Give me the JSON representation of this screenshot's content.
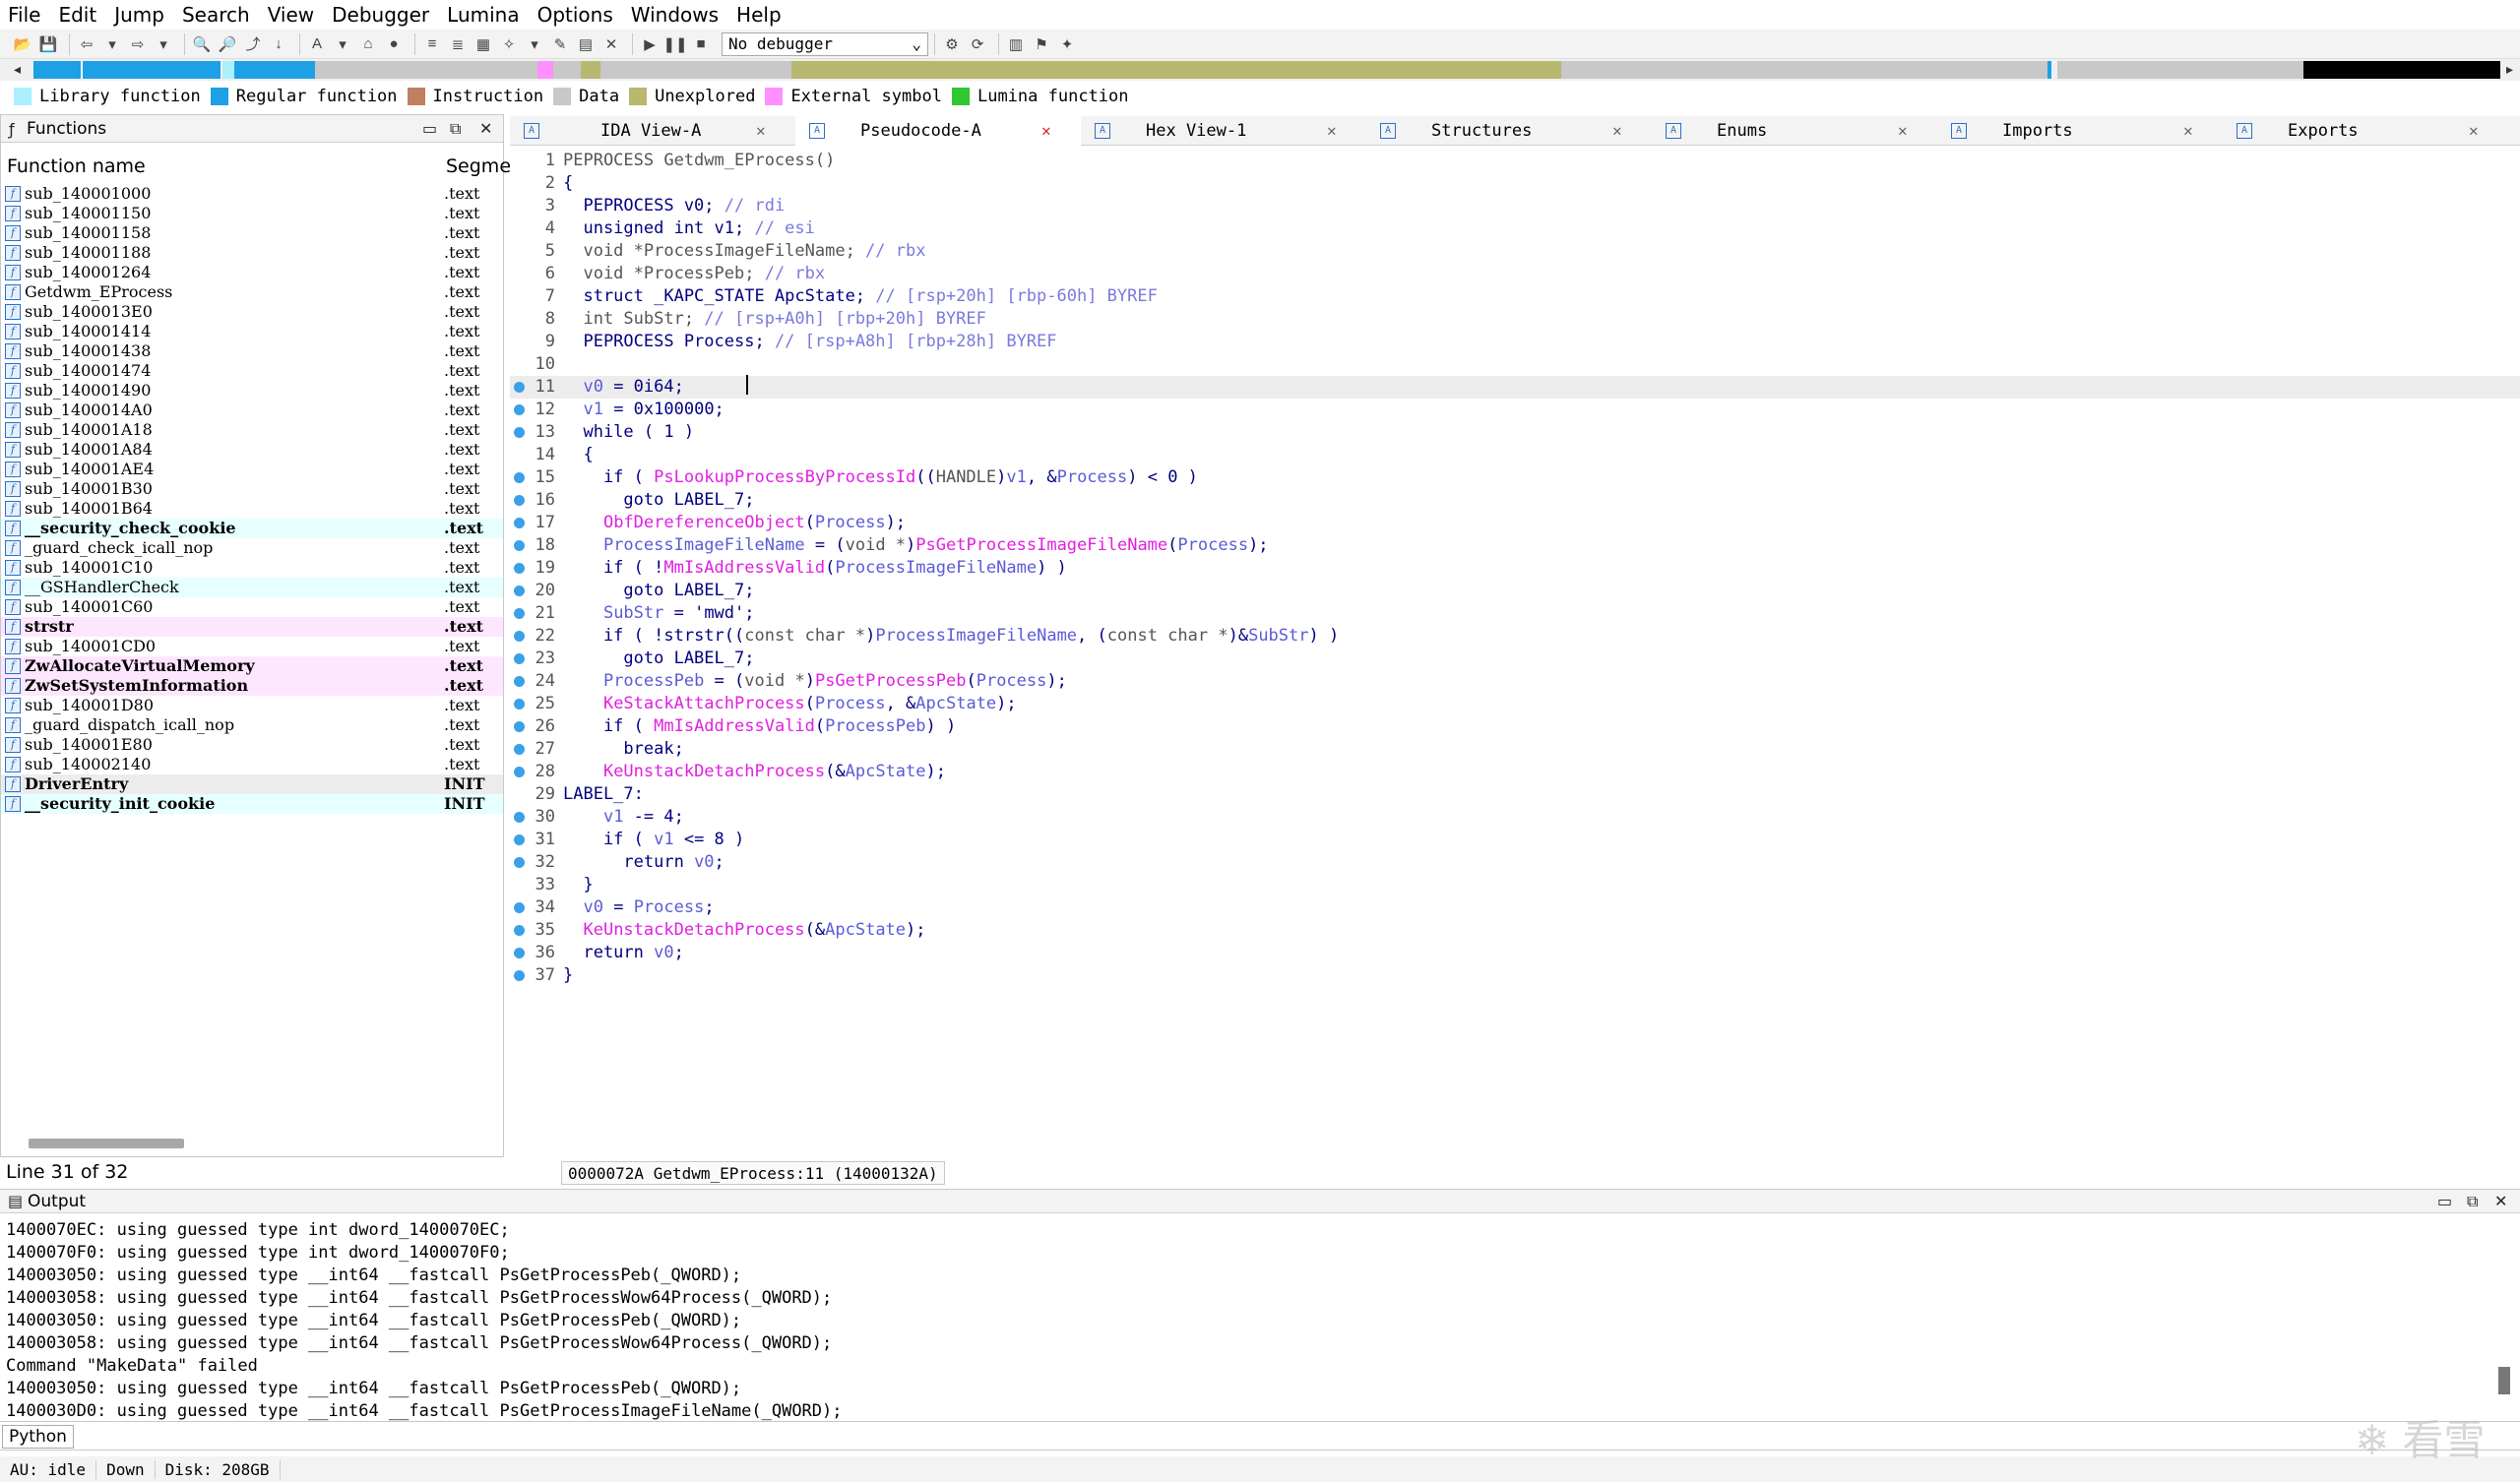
{
  "menu": [
    "File",
    "Edit",
    "Jump",
    "Search",
    "View",
    "Debugger",
    "Lumina",
    "Options",
    "Windows",
    "Help"
  ],
  "toolbar": {
    "debugger_value": "No debugger"
  },
  "legend": [
    {
      "label": "Library function",
      "color": "#aaf0ff"
    },
    {
      "label": "Regular function",
      "color": "#1ea0e6"
    },
    {
      "label": "Instruction",
      "color": "#c08060"
    },
    {
      "label": "Data",
      "color": "#c8c8c8"
    },
    {
      "label": "Unexplored",
      "color": "#b8b870"
    },
    {
      "label": "External symbol",
      "color": "#ff90ff"
    },
    {
      "label": "Lumina function",
      "color": "#30c830"
    }
  ],
  "functions_panel": {
    "title": "Functions",
    "col_name": "Function name",
    "col_segment": "Segme",
    "rows": [
      {
        "name": "sub_140001000",
        "seg": ".text",
        "kind": "reg"
      },
      {
        "name": "sub_140001150",
        "seg": ".text",
        "kind": "reg"
      },
      {
        "name": "sub_140001158",
        "seg": ".text",
        "kind": "reg"
      },
      {
        "name": "sub_140001188",
        "seg": ".text",
        "kind": "reg"
      },
      {
        "name": "sub_140001264",
        "seg": ".text",
        "kind": "reg"
      },
      {
        "name": "Getdwm_EProcess",
        "seg": ".text",
        "kind": "reg"
      },
      {
        "name": "sub_1400013E0",
        "seg": ".text",
        "kind": "reg"
      },
      {
        "name": "sub_140001414",
        "seg": ".text",
        "kind": "reg"
      },
      {
        "name": "sub_140001438",
        "seg": ".text",
        "kind": "reg"
      },
      {
        "name": "sub_140001474",
        "seg": ".text",
        "kind": "reg"
      },
      {
        "name": "sub_140001490",
        "seg": ".text",
        "kind": "reg"
      },
      {
        "name": "sub_1400014A0",
        "seg": ".text",
        "kind": "reg"
      },
      {
        "name": "sub_140001A18",
        "seg": ".text",
        "kind": "reg"
      },
      {
        "name": "sub_140001A84",
        "seg": ".text",
        "kind": "reg"
      },
      {
        "name": "sub_140001AE4",
        "seg": ".text",
        "kind": "reg"
      },
      {
        "name": "sub_140001B30",
        "seg": ".text",
        "kind": "reg"
      },
      {
        "name": "sub_140001B64",
        "seg": ".text",
        "kind": "reg"
      },
      {
        "name": "__security_check_cookie",
        "seg": ".text",
        "kind": "lib",
        "bold": true
      },
      {
        "name": "_guard_check_icall_nop",
        "seg": ".text",
        "kind": "reg"
      },
      {
        "name": "sub_140001C10",
        "seg": ".text",
        "kind": "reg"
      },
      {
        "name": "__GSHandlerCheck",
        "seg": ".text",
        "kind": "lib"
      },
      {
        "name": "sub_140001C60",
        "seg": ".text",
        "kind": "reg"
      },
      {
        "name": "strstr",
        "seg": ".text",
        "kind": "ext",
        "bold": true
      },
      {
        "name": "sub_140001CD0",
        "seg": ".text",
        "kind": "reg"
      },
      {
        "name": "ZwAllocateVirtualMemory",
        "seg": ".text",
        "kind": "ext",
        "bold": true
      },
      {
        "name": "ZwSetSystemInformation",
        "seg": ".text",
        "kind": "ext",
        "bold": true
      },
      {
        "name": "sub_140001D80",
        "seg": ".text",
        "kind": "reg"
      },
      {
        "name": "_guard_dispatch_icall_nop",
        "seg": ".text",
        "kind": "reg"
      },
      {
        "name": "sub_140001E80",
        "seg": ".text",
        "kind": "reg"
      },
      {
        "name": "sub_140002140",
        "seg": ".text",
        "kind": "reg"
      },
      {
        "name": "DriverEntry",
        "seg": "INIT",
        "kind": "sel",
        "bold": true
      },
      {
        "name": "__security_init_cookie",
        "seg": "INIT",
        "kind": "lib",
        "bold": true
      }
    ],
    "status": "Line 31 of 32"
  },
  "tabs": [
    {
      "label": "IDA View-A",
      "icon": "ida-view-icon"
    },
    {
      "label": "Pseudocode-A",
      "icon": "pseudocode-icon",
      "active": true
    },
    {
      "label": "Hex View-1",
      "icon": "hex-view-icon"
    },
    {
      "label": "Structures",
      "icon": "structures-icon"
    },
    {
      "label": "Enums",
      "icon": "enums-icon"
    },
    {
      "label": "Imports",
      "icon": "imports-icon"
    },
    {
      "label": "Exports",
      "icon": "exports-icon"
    }
  ],
  "pseudocode": {
    "lines": [
      {
        "n": "1",
        "dot": false,
        "html": "<span class='gray'>PEPROCESS Getdwm_EProcess()</span>"
      },
      {
        "n": "2",
        "dot": false,
        "html": "<span class='kw'>{</span>"
      },
      {
        "n": "3",
        "dot": false,
        "html": "<span class='kw'>  PEPROCESS v0; </span><span class='cm'>// rdi</span>"
      },
      {
        "n": "4",
        "dot": false,
        "html": "<span class='kw'>  unsigned int v1; </span><span class='cm'>// esi</span>"
      },
      {
        "n": "5",
        "dot": false,
        "html": "<span class='gray'>  void *ProcessImageFileName; </span><span class='cm'>// rbx</span>"
      },
      {
        "n": "6",
        "dot": false,
        "html": "<span class='gray'>  void *ProcessPeb; </span><span class='cm'>// rbx</span>"
      },
      {
        "n": "7",
        "dot": false,
        "html": "<span class='kw'>  struct _KAPC_STATE ApcState; </span><span class='cm'>// [rsp+20h] [rbp-60h] BYREF</span>"
      },
      {
        "n": "8",
        "dot": false,
        "html": "<span class='gray'>  int SubStr; </span><span class='cm'>// [rsp+A0h] [rbp+20h] BYREF</span>"
      },
      {
        "n": "9",
        "dot": false,
        "html": "<span class='kw'>  PEPROCESS Process; </span><span class='cm'>// [rsp+A8h] [rbp+28h] BYREF</span>"
      },
      {
        "n": "10",
        "dot": false,
        "html": ""
      },
      {
        "n": "11",
        "dot": true,
        "cur": true,
        "html": "  <span class='vr'>v0</span><span class='kw'> = 0i64;</span>"
      },
      {
        "n": "12",
        "dot": true,
        "html": "  <span class='vr'>v1</span><span class='kw'> = 0x100000;</span>"
      },
      {
        "n": "13",
        "dot": true,
        "html": "<span class='kw'>  while ( 1 )</span>"
      },
      {
        "n": "14",
        "dot": false,
        "html": "<span class='kw'>  {</span>"
      },
      {
        "n": "15",
        "dot": true,
        "html": "<span class='kw'>    if ( </span><span class='fn'>PsLookupProcessByProcessId</span><span class='kw'>((</span><span class='gray'>HANDLE</span><span class='kw'>)</span><span class='vr'>v1</span><span class='kw'>, &amp;</span><span class='vr'>Process</span><span class='kw'>) &lt; 0 )</span>"
      },
      {
        "n": "16",
        "dot": true,
        "html": "<span class='kw'>      goto LABEL_7;</span>"
      },
      {
        "n": "17",
        "dot": true,
        "html": "    <span class='fn'>ObfDereferenceObject</span><span class='kw'>(</span><span class='vr'>Process</span><span class='kw'>);</span>"
      },
      {
        "n": "18",
        "dot": true,
        "html": "    <span class='vr'>ProcessImageFileName</span><span class='kw'> = (</span><span class='gray'>void *</span><span class='kw'>)</span><span class='fn'>PsGetProcessImageFileName</span><span class='kw'>(</span><span class='vr'>Process</span><span class='kw'>);</span>"
      },
      {
        "n": "19",
        "dot": true,
        "html": "<span class='kw'>    if ( !</span><span class='fn'>MmIsAddressValid</span><span class='kw'>(</span><span class='vr'>ProcessImageFileName</span><span class='kw'>) )</span>"
      },
      {
        "n": "20",
        "dot": true,
        "html": "<span class='kw'>      goto LABEL_7;</span>"
      },
      {
        "n": "21",
        "dot": true,
        "html": "    <span class='vr'>SubStr</span><span class='kw'> = 'mwd';</span>"
      },
      {
        "n": "22",
        "dot": true,
        "html": "<span class='kw'>    if ( !</span><span class='st'>strstr</span><span class='kw'>((</span><span class='gray'>const char *</span><span class='kw'>)</span><span class='vr'>ProcessImageFileName</span><span class='kw'>, (</span><span class='gray'>const char *</span><span class='kw'>)&amp;</span><span class='vr'>SubStr</span><span class='kw'>) )</span>"
      },
      {
        "n": "23",
        "dot": true,
        "html": "<span class='kw'>      goto LABEL_7;</span>"
      },
      {
        "n": "24",
        "dot": true,
        "html": "    <span class='vr'>ProcessPeb</span><span class='kw'> = (</span><span class='gray'>void *</span><span class='kw'>)</span><span class='fn'>PsGetProcessPeb</span><span class='kw'>(</span><span class='vr'>Process</span><span class='kw'>);</span>"
      },
      {
        "n": "25",
        "dot": true,
        "html": "    <span class='fn'>KeStackAttachProcess</span><span class='kw'>(</span><span class='vr'>Process</span><span class='kw'>, &amp;</span><span class='vr'>ApcState</span><span class='kw'>);</span>"
      },
      {
        "n": "26",
        "dot": true,
        "html": "<span class='kw'>    if ( </span><span class='fn'>MmIsAddressValid</span><span class='kw'>(</span><span class='vr'>ProcessPeb</span><span class='kw'>) )</span>"
      },
      {
        "n": "27",
        "dot": true,
        "html": "<span class='kw'>      break;</span>"
      },
      {
        "n": "28",
        "dot": true,
        "html": "    <span class='fn'>KeUnstackDetachProcess</span><span class='kw'>(&amp;</span><span class='vr'>ApcState</span><span class='kw'>);</span>"
      },
      {
        "n": "29",
        "dot": false,
        "html": "<span class='kw'>LABEL_7:</span>"
      },
      {
        "n": "30",
        "dot": true,
        "html": "    <span class='vr'>v1</span><span class='kw'> -= 4;</span>"
      },
      {
        "n": "31",
        "dot": true,
        "html": "<span class='kw'>    if ( </span><span class='vr'>v1</span><span class='kw'> &lt;= 8 )</span>"
      },
      {
        "n": "32",
        "dot": true,
        "html": "<span class='kw'>      return </span><span class='vr'>v0</span><span class='kw'>;</span>"
      },
      {
        "n": "33",
        "dot": false,
        "html": "<span class='kw'>  }</span>"
      },
      {
        "n": "34",
        "dot": true,
        "html": "  <span class='vr'>v0</span><span class='kw'> = </span><span class='vr'>Process</span><span class='kw'>;</span>"
      },
      {
        "n": "35",
        "dot": true,
        "html": "  <span class='fn'>KeUnstackDetachProcess</span><span class='kw'>(&amp;</span><span class='vr'>ApcState</span><span class='kw'>);</span>"
      },
      {
        "n": "36",
        "dot": true,
        "html": "<span class='kw'>  return </span><span class='vr'>v0</span><span class='kw'>;</span>"
      },
      {
        "n": "37",
        "dot": true,
        "html": "<span class='kw'>}</span>"
      }
    ],
    "status": "0000072A Getdwm_EProcess:11 (14000132A)"
  },
  "output": {
    "title": "Output",
    "lines": [
      "1400070EC: using guessed type int dword_1400070EC;",
      "1400070F0: using guessed type int dword_1400070F0;",
      "140003050: using guessed type __int64 __fastcall PsGetProcessPeb(_QWORD);",
      "140003058: using guessed type __int64 __fastcall PsGetProcessWow64Process(_QWORD);",
      "140003050: using guessed type __int64 __fastcall PsGetProcessPeb(_QWORD);",
      "140003058: using guessed type __int64 __fastcall PsGetProcessWow64Process(_QWORD);",
      "Command \"MakeData\" failed",
      "140003050: using guessed type __int64 __fastcall PsGetProcessPeb(_QWORD);",
      "1400030D0: using guessed type __int64 __fastcall PsGetProcessImageFileName(_QWORD);"
    ],
    "python_label": "Python"
  },
  "statusbar": {
    "au": "AU:  idle",
    "dir": "Down",
    "disk": "Disk: 208GB"
  },
  "watermark": "看雪"
}
